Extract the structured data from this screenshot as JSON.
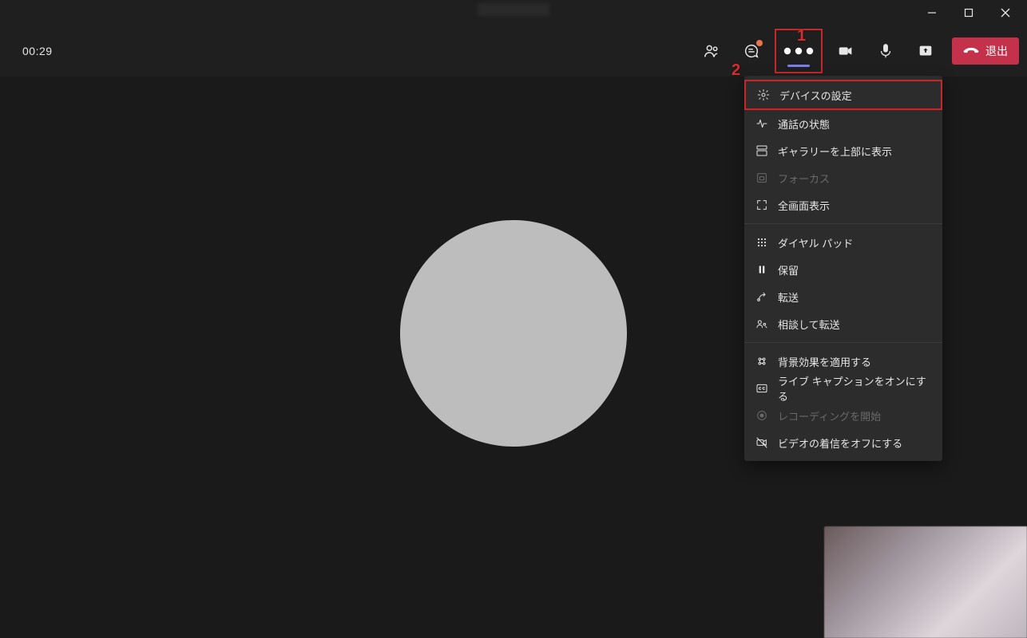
{
  "titlebar": {},
  "toolbar": {
    "timer": "00:29",
    "leave_label": "退出"
  },
  "annotations": {
    "n1": "1",
    "n2": "2"
  },
  "menu": {
    "sections": [
      [
        {
          "key": "device_settings",
          "label": "デバイスの設定",
          "icon": "gear",
          "disabled": false,
          "highlight": true
        },
        {
          "key": "call_health",
          "label": "通話の状態",
          "icon": "activity",
          "disabled": false
        },
        {
          "key": "gallery_top",
          "label": "ギャラリーを上部に表示",
          "icon": "layout",
          "disabled": false
        },
        {
          "key": "focus",
          "label": "フォーカス",
          "icon": "focus",
          "disabled": true
        },
        {
          "key": "fullscreen",
          "label": "全画面表示",
          "icon": "fullscreen",
          "disabled": false
        }
      ],
      [
        {
          "key": "dialpad",
          "label": "ダイヤル パッド",
          "icon": "dialpad",
          "disabled": false
        },
        {
          "key": "hold",
          "label": "保留",
          "icon": "pause",
          "disabled": false
        },
        {
          "key": "transfer",
          "label": "転送",
          "icon": "transfer",
          "disabled": false
        },
        {
          "key": "consult_transfer",
          "label": "相談して転送",
          "icon": "consult",
          "disabled": false
        }
      ],
      [
        {
          "key": "bg_effects",
          "label": "背景効果を適用する",
          "icon": "sparkle",
          "disabled": false
        },
        {
          "key": "live_captions",
          "label": "ライブ キャプションをオンにする",
          "icon": "cc",
          "disabled": false
        },
        {
          "key": "start_recording",
          "label": "レコーディングを開始",
          "icon": "record",
          "disabled": true
        },
        {
          "key": "incoming_video_off",
          "label": "ビデオの着信をオフにする",
          "icon": "video-off",
          "disabled": false
        }
      ]
    ]
  }
}
